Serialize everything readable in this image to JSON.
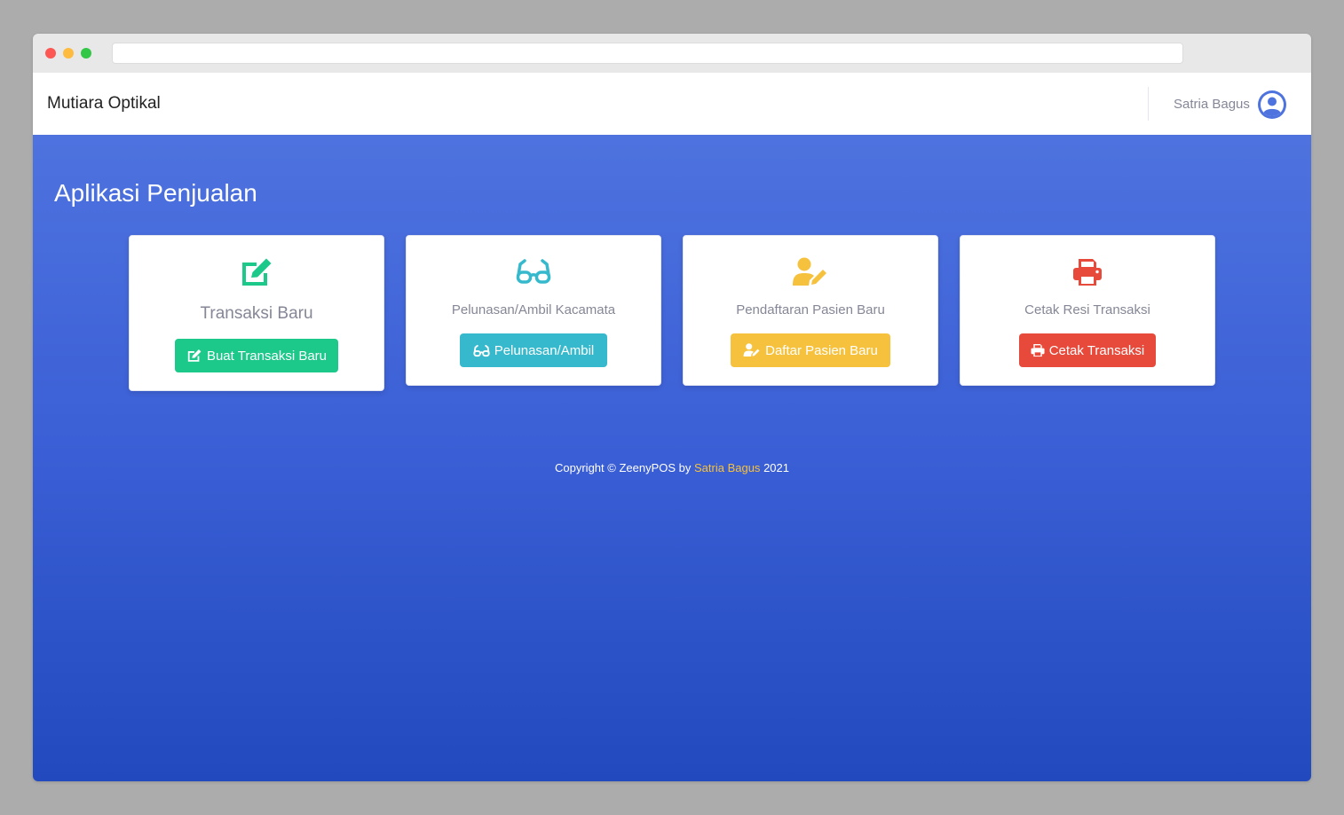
{
  "navbar": {
    "brand": "Mutiara Optikal",
    "user_name": "Satria Bagus"
  },
  "page": {
    "title": "Aplikasi Penjualan"
  },
  "cards": [
    {
      "title": "Transaksi Baru",
      "button_label": "Buat Transaksi Baru",
      "icon": "edit-icon",
      "color": "#1cc88a"
    },
    {
      "title": "Pelunasan/Ambil Kacamata",
      "button_label": "Pelunasan/Ambil",
      "icon": "glasses-icon",
      "color": "#36b9cc"
    },
    {
      "title": "Pendaftaran Pasien Baru",
      "button_label": "Daftar Pasien Baru",
      "icon": "user-edit-icon",
      "color": "#f6c23e"
    },
    {
      "title": "Cetak Resi Transaksi",
      "button_label": "Cetak Transaksi",
      "icon": "print-icon",
      "color": "#e74a3b"
    }
  ],
  "footer": {
    "prefix": "Copyright © ZeenyPOS by",
    "author": "Satria Bagus",
    "year": "2021"
  },
  "colors": {
    "primary": "#4e73df",
    "success": "#1cc88a",
    "info": "#36b9cc",
    "warning": "#f6c23e",
    "danger": "#e74a3b"
  }
}
